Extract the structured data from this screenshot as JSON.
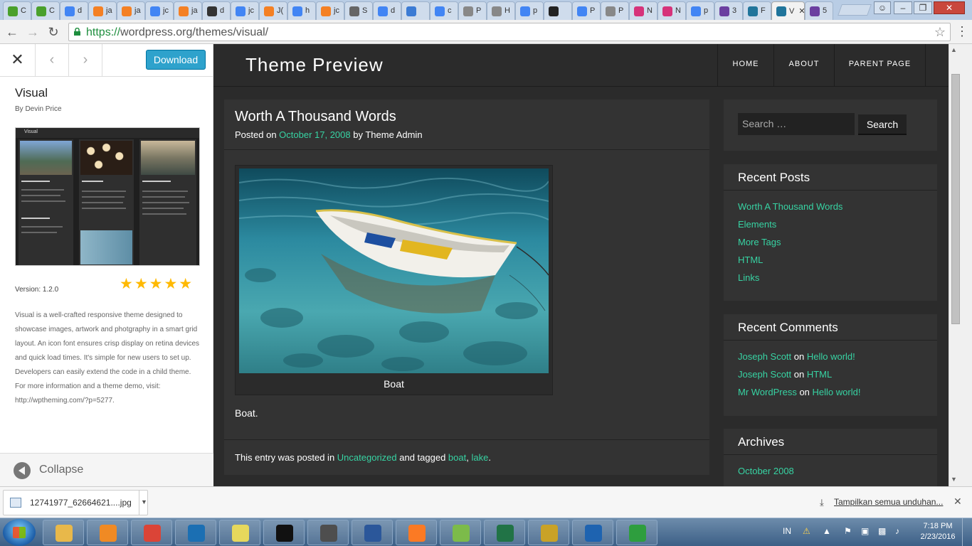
{
  "browser": {
    "tabs": [
      {
        "label": "C",
        "icon": "green-circle-icon",
        "color": "#4aa02c"
      },
      {
        "label": "C",
        "icon": "green-circle-icon",
        "color": "#4aa02c"
      },
      {
        "label": "d",
        "icon": "google-icon",
        "color": "#4285f4"
      },
      {
        "label": "ja",
        "icon": "stackoverflow-icon",
        "color": "#f48024"
      },
      {
        "label": "ja",
        "icon": "stackoverflow-icon",
        "color": "#f48024"
      },
      {
        "label": "jc",
        "icon": "google-icon",
        "color": "#4285f4"
      },
      {
        "label": "ja",
        "icon": "stackoverflow-icon",
        "color": "#f48024"
      },
      {
        "label": "d",
        "icon": "code-icon",
        "color": "#333333"
      },
      {
        "label": "jc",
        "icon": "google-icon",
        "color": "#4285f4"
      },
      {
        "label": "J(",
        "icon": "stackoverflow-icon",
        "color": "#f48024"
      },
      {
        "label": "h",
        "icon": "google-icon",
        "color": "#4285f4"
      },
      {
        "label": "jc",
        "icon": "stackoverflow-icon",
        "color": "#f48024"
      },
      {
        "label": "S",
        "icon": "gear-icon",
        "color": "#666666"
      },
      {
        "label": "d",
        "icon": "google-icon",
        "color": "#4285f4"
      },
      {
        "label": "",
        "icon": "moon-icon",
        "color": "#3b7bd4"
      },
      {
        "label": "c",
        "icon": "google-icon",
        "color": "#4285f4"
      },
      {
        "label": "P",
        "icon": "document-icon",
        "color": "#888888"
      },
      {
        "label": "H",
        "icon": "document-icon",
        "color": "#888888"
      },
      {
        "label": "p",
        "icon": "google-icon",
        "color": "#4285f4"
      },
      {
        "label": "",
        "icon": "github-icon",
        "color": "#222222"
      },
      {
        "label": "P",
        "icon": "google-icon",
        "color": "#4285f4"
      },
      {
        "label": "P",
        "icon": "document-icon",
        "color": "#888888"
      },
      {
        "label": "N",
        "icon": "asterisk-icon",
        "color": "#d6337a"
      },
      {
        "label": "N",
        "icon": "asterisk-icon",
        "color": "#d6337a"
      },
      {
        "label": "p",
        "icon": "google-icon",
        "color": "#4285f4"
      },
      {
        "label": "3",
        "icon": "colorlib-icon",
        "color": "#6b3fa0"
      },
      {
        "label": "F",
        "icon": "wordpress-icon",
        "color": "#21759b"
      },
      {
        "label": "V",
        "icon": "wordpress-icon",
        "color": "#21759b",
        "active": true
      },
      {
        "label": "5",
        "icon": "colorlib-icon",
        "color": "#6b3fa0"
      }
    ],
    "url_secure": "https://",
    "url_rest": "wordpress.org/themes/visual/"
  },
  "sidebar": {
    "download_label": "Download",
    "theme_name": "Visual",
    "author": "By Devin Price",
    "screenshot_title": "Visual",
    "rating_stars": "★★★★★",
    "rating": 5,
    "version": "Version: 1.2.0",
    "description": "Visual is a well-crafted responsive theme designed to showcase images, artwork and photgraphy in a smart grid layout. An icon font ensures crisp display on retina devices and quick load times. It's simple for new users to set up. Developers can easily extend the code in a child theme. For more information and a theme demo, visit: http://wptheming.com/?p=5277.",
    "collapse_label": "Collapse"
  },
  "preview": {
    "site_title": "Theme Preview",
    "nav": [
      "HOME",
      "ABOUT",
      "PARENT PAGE"
    ],
    "post": {
      "title": "Worth A Thousand Words",
      "meta_prefix": "Posted on ",
      "date": "October 17, 2008",
      "meta_by": " by ",
      "author": "Theme Admin",
      "caption": "Boat",
      "body": "Boat.",
      "foot_prefix": "This entry was posted in ",
      "category": "Uncategorized",
      "foot_tagged": " and tagged ",
      "tag1": "boat",
      "tag_sep": ", ",
      "tag2": "lake",
      "foot_end": "."
    },
    "search": {
      "placeholder": "Search …",
      "button": "Search"
    },
    "recent_posts": {
      "title": "Recent Posts",
      "items": [
        "Worth A Thousand Words",
        "Elements",
        "More Tags",
        "HTML",
        "Links"
      ]
    },
    "recent_comments": {
      "title": "Recent Comments",
      "on": " on ",
      "items": [
        {
          "author": "Joseph Scott",
          "post": "Hello world!"
        },
        {
          "author": "Joseph Scott",
          "post": "HTML"
        },
        {
          "author": "Mr WordPress",
          "post": "Hello world!"
        }
      ]
    },
    "archives": {
      "title": "Archives",
      "items": [
        "October 2008"
      ]
    },
    "accent_color": "#37d3a3"
  },
  "downloads": {
    "file_name": "12741977_62664621....jpg",
    "show_all": "Tampilkan semua unduhan..."
  },
  "taskbar": {
    "apps": [
      {
        "icon": "explorer-icon",
        "color": "#e8b84a"
      },
      {
        "icon": "media-player-icon",
        "color": "#f08a24"
      },
      {
        "icon": "chrome-icon",
        "color": "#db4437"
      },
      {
        "icon": "sourcetree-icon",
        "color": "#1b6fb3"
      },
      {
        "icon": "sticky-notes-icon",
        "color": "#e6d85c"
      },
      {
        "icon": "terminal-icon",
        "color": "#111111"
      },
      {
        "icon": "sublime-text-icon",
        "color": "#4e4e4e"
      },
      {
        "icon": "word-icon",
        "color": "#2b579a"
      },
      {
        "icon": "xampp-icon",
        "color": "#fb7a24"
      },
      {
        "icon": "notepad-plus-icon",
        "color": "#7cbb4a"
      },
      {
        "icon": "excel-icon",
        "color": "#217346"
      },
      {
        "icon": "network-tool-icon",
        "color": "#c9a227"
      },
      {
        "icon": "virtualbox-icon",
        "color": "#1e63b0"
      },
      {
        "icon": "download-manager-icon",
        "color": "#2e9e3e"
      }
    ],
    "lang": "IN",
    "time": "7:18 PM",
    "date": "2/23/2016"
  }
}
